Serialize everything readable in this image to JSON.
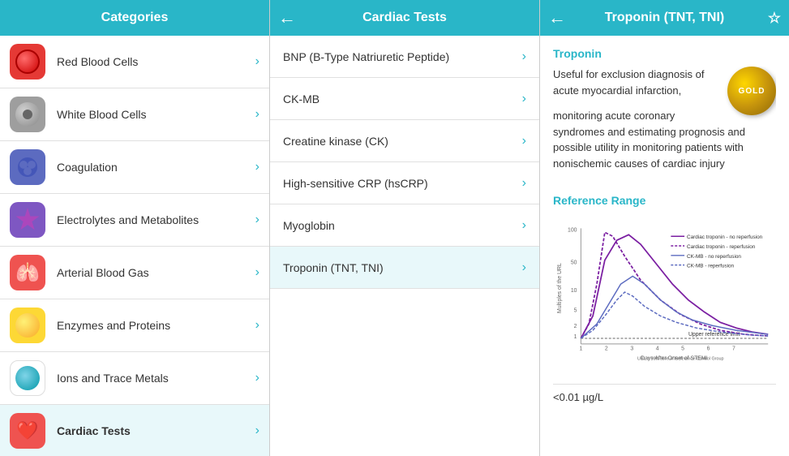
{
  "categories": {
    "header": "Categories",
    "items": [
      {
        "id": "rbc",
        "label": "Red Blood Cells",
        "icon_type": "rbc"
      },
      {
        "id": "wbc",
        "label": "White Blood Cells",
        "icon_type": "wbc"
      },
      {
        "id": "coag",
        "label": "Coagulation",
        "icon_type": "coag"
      },
      {
        "id": "electro",
        "label": "Electrolytes and Metabolites",
        "icon_type": "electro"
      },
      {
        "id": "abg",
        "label": "Arterial Blood Gas",
        "icon_type": "abg"
      },
      {
        "id": "enzyme",
        "label": "Enzymes and Proteins",
        "icon_type": "enzyme"
      },
      {
        "id": "ions",
        "label": "Ions and Trace Metals",
        "icon_type": "ions"
      },
      {
        "id": "cardiac",
        "label": "Cardiac Tests",
        "icon_type": "cardiac"
      }
    ],
    "chevron": "›"
  },
  "cardiac_tests": {
    "header": "Cardiac Tests",
    "back_icon": "←",
    "items": [
      {
        "id": "bnp",
        "label": "BNP (B-Type Natriuretic Peptide)"
      },
      {
        "id": "ckmb",
        "label": "CK-MB"
      },
      {
        "id": "ck",
        "label": "Creatine kinase (CK)"
      },
      {
        "id": "hscrp",
        "label": "High-sensitive CRP (hsCRP)"
      },
      {
        "id": "myoglobin",
        "label": "Myoglobin"
      },
      {
        "id": "troponin",
        "label": "Troponin (TNT, TNI)"
      }
    ],
    "chevron": "›"
  },
  "detail": {
    "header": "Troponin (TNT, TNI)",
    "back_icon": "←",
    "star_icon": "☆",
    "section_troponin": "Troponin",
    "badge_text": "GOLD",
    "description1": "Useful for  exclusion diagnosis of acute myocardial infarction,",
    "description2": "monitoring acute coronary syndromes and estimating prognosis and  possible utility in monitoring patients with nonischemic causes of cardiac injury",
    "section_reference": "Reference Range",
    "chart_y_label": "Multiples of the URL",
    "chart_x_label": "Days After Onset of STEMI",
    "legend": [
      {
        "label": "Cardiac troponin - no reperfusion",
        "style": "solid",
        "color": "#7b1fa2"
      },
      {
        "label": "Cardiac troponin - reperfusion",
        "style": "dashed",
        "color": "#7b1fa2"
      },
      {
        "label": "CK-MB - no reperfusion",
        "style": "solid",
        "color": "#5c6bc0"
      },
      {
        "label": "CK-MB - reperfusion",
        "style": "dashed",
        "color": "#5c6bc0"
      }
    ],
    "upper_ref_label": "Upper reference limit",
    "url_note": "URL = 99th %ile of Reference Control Group",
    "reference_value": "<0.01 µg/L"
  }
}
